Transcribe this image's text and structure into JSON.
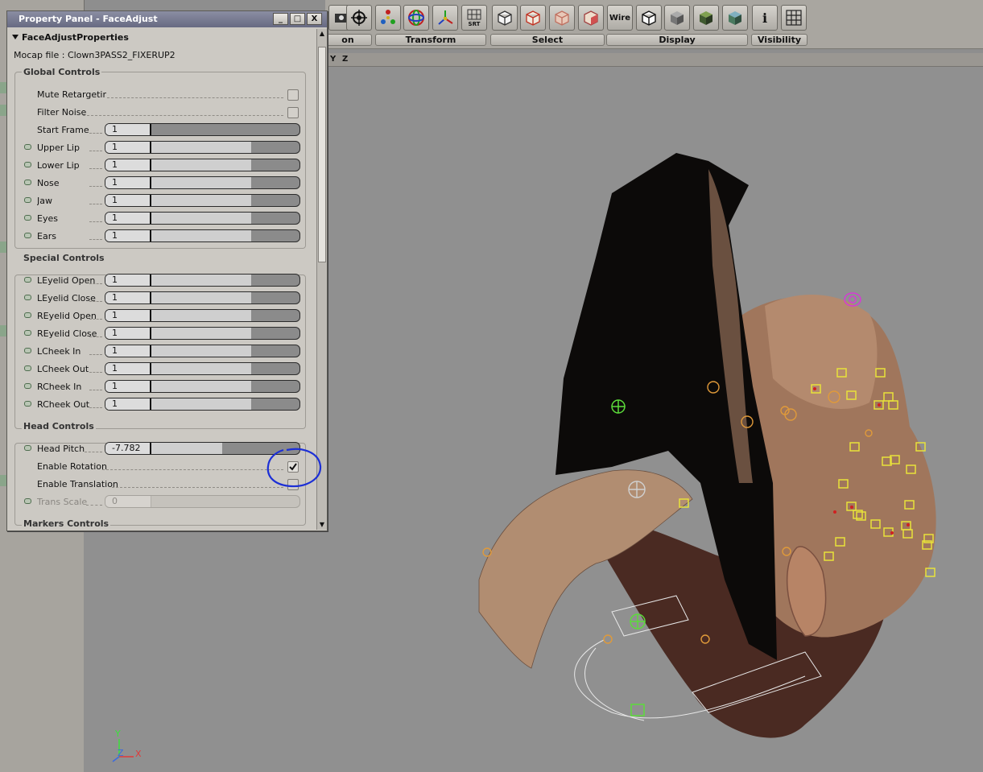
{
  "panel": {
    "title": "Property Panel - FaceAdjust",
    "window_buttons": [
      "_",
      "□",
      "X"
    ],
    "section": "FaceAdjustProperties",
    "mocap_label": "Mocap file : Clown3PASS2_FIXERUP2"
  },
  "groups": {
    "global": {
      "title": "Global Controls",
      "mute_retargeting": "Mute Retargeting",
      "filter_noise": "Filter Noise",
      "rows": [
        {
          "label": "Start Frame",
          "value": "1",
          "led": false
        },
        {
          "label": "Upper Lip",
          "value": "1",
          "led": true
        },
        {
          "label": "Lower Lip",
          "value": "1",
          "led": true
        },
        {
          "label": "Nose",
          "value": "1",
          "led": true
        },
        {
          "label": "Jaw",
          "value": "1",
          "led": true
        },
        {
          "label": "Eyes",
          "value": "1",
          "led": true
        },
        {
          "label": "Ears",
          "value": "1",
          "led": true
        }
      ]
    },
    "special": {
      "title": "Special Controls",
      "rows": [
        {
          "label": "LEyelid Open",
          "value": "1"
        },
        {
          "label": "LEyelid Close",
          "value": "1"
        },
        {
          "label": "REyelid Open",
          "value": "1"
        },
        {
          "label": "REyelid Close",
          "value": "1"
        },
        {
          "label": "LCheek In",
          "value": "1"
        },
        {
          "label": "LCheek Out",
          "value": "1"
        },
        {
          "label": "RCheek In",
          "value": "1"
        },
        {
          "label": "RCheek Out",
          "value": "1"
        }
      ]
    },
    "head": {
      "title": "Head Controls",
      "head_pitch_label": "Head Pitch",
      "head_pitch_value": "-7.782",
      "enable_rotation": "Enable Rotation",
      "enable_translation": "Enable Translation",
      "trans_scale_label": "Trans Scale",
      "trans_scale_value": "0"
    },
    "markers": {
      "title": "Markers Controls"
    }
  },
  "toolbar": {
    "wire_label": "Wire",
    "srt_label": "SRT",
    "info_label": "i",
    "tabs": [
      "on",
      "Transform",
      "Select",
      "Display",
      "Visibility"
    ]
  },
  "axis_bar": {
    "y": "Y",
    "z": "Z"
  },
  "gizmo": {
    "y": "Y",
    "z": "Z",
    "x": "X"
  },
  "colors": {
    "annotation_circle": "#1c2fd6",
    "marker_yellow": "#e8e23a",
    "marker_orange": "#e09a3a",
    "marker_green": "#5cdc3a",
    "marker_magenta": "#d63ad6"
  }
}
